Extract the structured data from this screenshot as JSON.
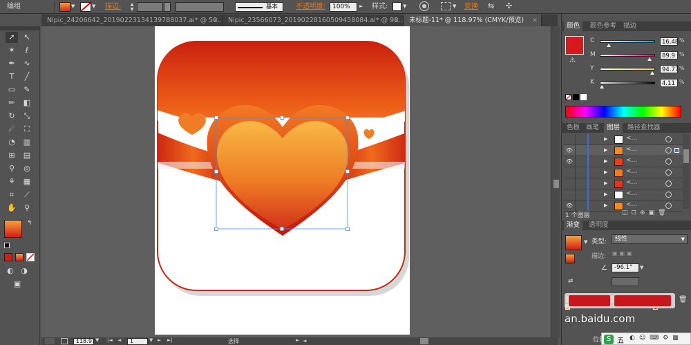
{
  "control_bar": {
    "mode_label": "编组",
    "stroke_label": "描边:",
    "stroke_style": "基本",
    "opacity_label": "不透明度:",
    "opacity_value": "100%",
    "style_label": "样式:",
    "transform_label": "变换"
  },
  "tabs": [
    {
      "label": "Nipic_24206642_20190223134139788037.ai* @ 50...",
      "active": false
    },
    {
      "label": "Nipic_23566073_20190228160509458084.ai* @ 98...",
      "active": false
    },
    {
      "label": "未标题-11* @ 118.97% (CMYK/预览)",
      "active": true
    }
  ],
  "status_bar": {
    "zoom": "118.97",
    "page": "1",
    "tool_name": "选择"
  },
  "color_panel": {
    "tabs": [
      "颜色",
      "颜色参考",
      "描边"
    ],
    "channels": [
      {
        "name": "C",
        "value": "16.48",
        "percent": 16.48,
        "color": "#00a0e0"
      },
      {
        "name": "M",
        "value": "89.9",
        "percent": 89.9,
        "color": "#e0007a"
      },
      {
        "name": "Y",
        "value": "94.77",
        "percent": 94.77,
        "color": "#f0e000"
      },
      {
        "name": "K",
        "value": "4.11",
        "percent": 4.11,
        "color": "#000000"
      }
    ],
    "fill_color": "#d7191c"
  },
  "layers_panel": {
    "tabs": [
      "色板",
      "画笔",
      "图层",
      "路径查找器"
    ],
    "footer": "1 个图层",
    "rows": [
      {
        "name": "<...",
        "visible": false,
        "thumb": "#ffffff"
      },
      {
        "name": "<...",
        "visible": true,
        "thumb": "#f08c2a"
      },
      {
        "name": "<...",
        "visible": true,
        "thumb": "#e2431c"
      },
      {
        "name": "<...",
        "visible": false,
        "thumb": "#ef7b22"
      },
      {
        "name": "<...",
        "visible": false,
        "thumb": "#d83a1a"
      },
      {
        "name": "<...",
        "visible": false,
        "thumb": "#ffffff"
      },
      {
        "name": "<...",
        "visible": true,
        "thumb": "#f08c2a"
      }
    ]
  },
  "gradient_panel": {
    "tabs": [
      "渐变",
      "透明度"
    ],
    "type_label": "类型:",
    "type_value": "线性",
    "stroke_label": "描边:",
    "angle_value": "-96.1°",
    "location_label": "位置"
  },
  "watermark": {
    "text": "an.baidu.com"
  },
  "taskbar": {
    "ime_label": "五"
  }
}
